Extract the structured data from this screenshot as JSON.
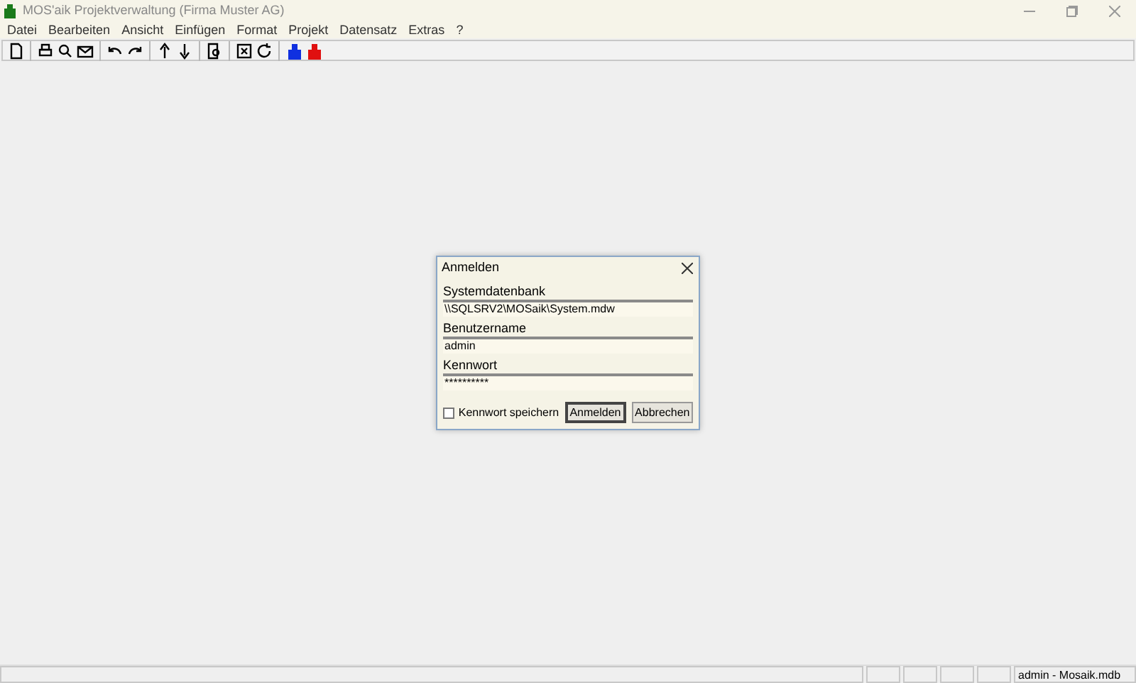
{
  "window": {
    "title": "MOS'aik Projektverwaltung (Firma Muster AG)"
  },
  "menu": [
    "Datei",
    "Bearbeiten",
    "Ansicht",
    "Einfügen",
    "Format",
    "Projekt",
    "Datensatz",
    "Extras",
    "?"
  ],
  "dialog": {
    "title": "Anmelden",
    "fields": [
      {
        "label": "Systemdatenbank",
        "value": "\\\\SQLSRV2\\MOSaik\\System.mdw"
      },
      {
        "label": "Benutzername",
        "value": "admin"
      },
      {
        "label": "Kennwort",
        "value": "**********"
      }
    ],
    "remember": {
      "label": "Kennwort speichern",
      "checked": false
    },
    "buttons": [
      {
        "label": "Anmelden",
        "default": true
      },
      {
        "label": "Abbrechen",
        "default": false
      }
    ]
  },
  "status_bar": {
    "user": "admin - Mosaik.mdb"
  }
}
